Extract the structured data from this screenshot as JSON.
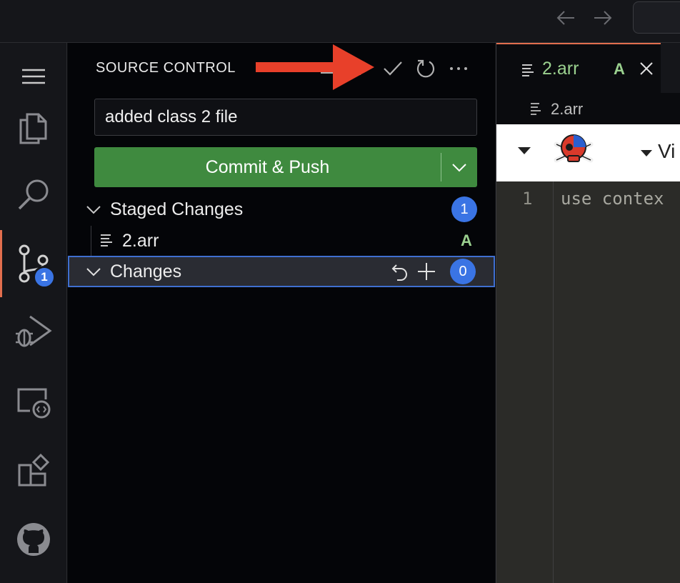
{
  "titlebar": {
    "back_icon": "arrow-left-icon",
    "forward_icon": "arrow-right-icon"
  },
  "activity_bar": {
    "items": [
      {
        "name": "menu",
        "icon": "hamburger-icon"
      },
      {
        "name": "explorer",
        "icon": "files-icon"
      },
      {
        "name": "search",
        "icon": "search-icon"
      },
      {
        "name": "source-control",
        "icon": "source-control-icon",
        "badge": "1",
        "active": true
      },
      {
        "name": "run-debug",
        "icon": "run-debug-icon"
      },
      {
        "name": "remote-explorer",
        "icon": "remote-explorer-icon"
      },
      {
        "name": "extensions",
        "icon": "extensions-icon"
      },
      {
        "name": "github",
        "icon": "github-icon"
      }
    ]
  },
  "source_control": {
    "title": "SOURCE CONTROL",
    "actions": [
      "tree-view-icon",
      "stage-icon",
      "commit-check-icon",
      "refresh-icon",
      "more-icon"
    ],
    "commit_message": "added class 2 file",
    "commit_button": "Commit & Push",
    "staged": {
      "label": "Staged Changes",
      "count": "1",
      "files": [
        {
          "name": "2.arr",
          "status": "A"
        }
      ]
    },
    "changes": {
      "label": "Changes",
      "count": "0"
    }
  },
  "editor": {
    "tab": {
      "name": "2.arr",
      "status": "A"
    },
    "breadcrumb": "2.arr",
    "toolbar_text": "Vi",
    "lines": [
      {
        "number": "1",
        "text": "use contex"
      }
    ]
  },
  "colors": {
    "accent": "#3a74e4",
    "commit": "#3f8a3f",
    "added": "#9bd18f",
    "arrow": "#e8402a",
    "active_indicator": "#e26e4e"
  }
}
